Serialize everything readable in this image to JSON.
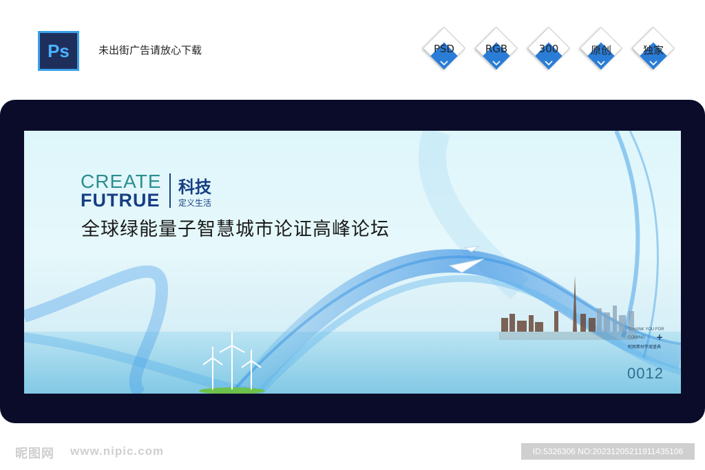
{
  "header": {
    "logo_text": "Ps",
    "note": "未出街广告请放心下载",
    "badges": [
      {
        "label": "PSD"
      },
      {
        "label": "RGB"
      },
      {
        "label": "300"
      },
      {
        "label": "原创"
      },
      {
        "label": "独家"
      }
    ]
  },
  "banner": {
    "create": "CREATE",
    "futrue": "FUTRUE",
    "keji": "科技",
    "sub": "定义生活",
    "title": "全球绿能量子智慧城市论证高峰论坛",
    "thank": "TI HANK  YOU FOR",
    "coming": "COMING",
    "plus": "+",
    "cn_small": "昵图素材年度盛典",
    "number": "0012"
  },
  "footer": {
    "logo": "昵图网",
    "url": "www.nipic.com",
    "id": "ID:5326306 NO:20231205211911435106"
  },
  "colors": {
    "frame": "#0b0c2a",
    "accent_blue": "#2a7dd6",
    "title_navy": "#173e83",
    "create_teal": "#2a8d8f"
  }
}
